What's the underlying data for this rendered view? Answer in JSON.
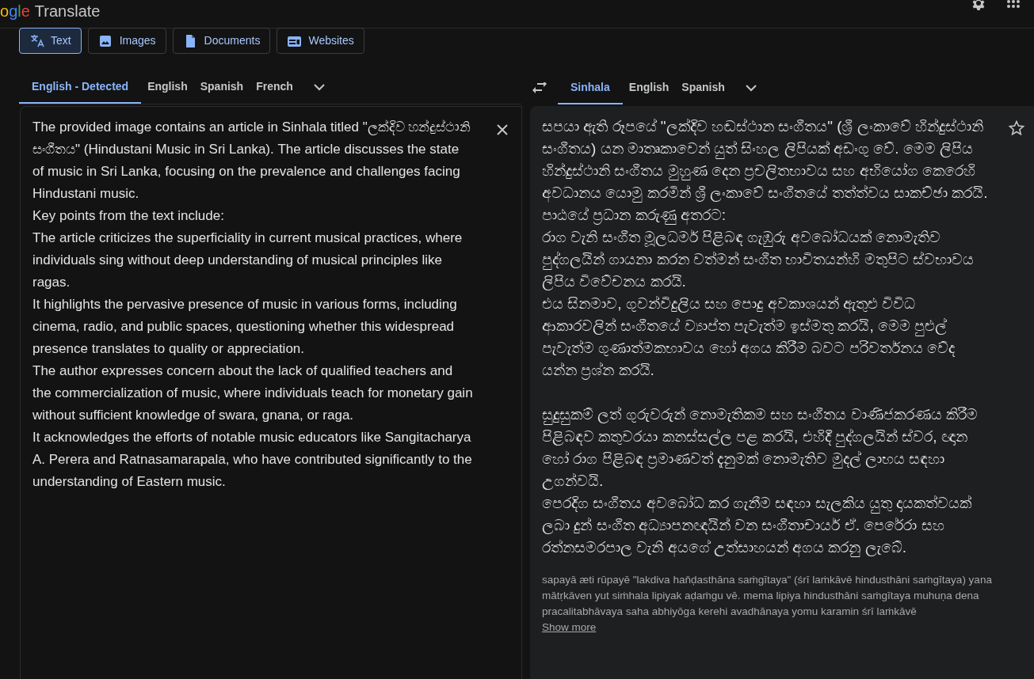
{
  "header": {
    "logo": "ogle",
    "title": "Translate"
  },
  "modes": [
    {
      "label": "Text",
      "kind": "text",
      "selected": true
    },
    {
      "label": "Images",
      "kind": "image",
      "selected": false
    },
    {
      "label": "Documents",
      "kind": "doc",
      "selected": false
    },
    {
      "label": "Websites",
      "kind": "web",
      "selected": false
    }
  ],
  "source_languages": [
    {
      "label": "English - Detected",
      "selected": true
    },
    {
      "label": "English",
      "selected": false
    },
    {
      "label": "Spanish",
      "selected": false
    },
    {
      "label": "French",
      "selected": false
    }
  ],
  "target_languages": [
    {
      "label": "Sinhala",
      "selected": true
    },
    {
      "label": "English",
      "selected": false
    },
    {
      "label": "Spanish",
      "selected": false
    }
  ],
  "source_text": [
    "The provided image contains an article in Sinhala titled \"ලක්දිව හන්දුස්ථානි සංගීතය\" (Hindustani Music in Sri Lanka). The article discusses the state of music in Sri Lanka, focusing on the prevalence and challenges facing Hindustani music.",
    "Key points from the text include:",
    "The article criticizes the superficiality in current musical practices, where individuals sing without deep understanding of musical principles like ragas.",
    "It highlights the pervasive presence of music in various forms, including cinema, radio, and public spaces, questioning whether this widespread presence translates to quality or appreciation.",
    "The author expresses concern about the lack of qualified teachers and the commercialization of music, where individuals teach for monetary gain without sufficient knowledge of swara, gnana, or raga.",
    "It acknowledges the efforts of notable music educators like Sangitacharya A. Perera and Ratnasamarapala, who have contributed significantly to the understanding of Eastern music."
  ],
  "translation": [
    [
      "සපයා ඇති රූපයේ \"ලක්දිව හඬස්ථාන සංගීතය\" (ශ්‍රී ලංකාවේ හින්දුස්ථානි සංගීතය) යන මාතෘකාවෙන් යුත් සිංහල ලිපියක් අඩංගු වේ. මෙම ලිපිය හින්දුස්ථානි සංගීතය මුහුණ දෙන ප්‍රචලිතභාවය සහ අභියෝග කෙරෙහි අවධානය යොමු කරමින් ශ්‍රී ලංකාවේ සංගීතයේ තත්ත්වය සාකච්ඡා කරයි.",
      "පාඨයේ ප්‍රධාන කරුණු අතරට:",
      "රාග වැනි සංගීත මූලධර්ම පිළිබඳ ගැඹුරු අවබෝධයක් නොමැතිව පුද්ගලයින් ගායනා කරන වත්මන් සංගීත භාවිතයන්හි මතුපිට ස්වභාවය ලිපිය විවේචනය කරයි.",
      "එය සිනමාව, ගුවන්විදුලිය සහ පොදු අවකාශයන් ඇතුළු විවිධ ආකාරවලින් සංගීතයේ ව්‍යාප්ත පැවැත්ම ඉස්මතු කරයි, මෙම පුළුල් පැවැත්ම ගුණාත්මකභාවය හෝ අගය කිරීම බවට පරිවර්තනය වේද යන්න ප්‍රශ්න කරයි."
    ],
    [
      "සුදුසුකම් ලත් ගුරුවරුන් නොමැතිකම සහ සංගීතය වාණිජකරණය කිරීම පිළිබඳව කතුවරයා කනස්සල්ල පළ කරයි, එහිදී පුද්ගලයින් ස්වර, ඥාන හෝ රාග පිළිබඳ ප්‍රමාණවත් දැනුමක් නොමැතිව මුදල් ලාභය සඳහා උගන්වයි.",
      "පෙරදිග සංගීතය අවබෝධ කර ගැනීම සඳහා සැලකිය යුතු දායකත්වයක් ලබා දුන් සංගීත අධ්‍යාපනඥයින් වන සංගීතාචාර්ය ඒ. පෙරේරා සහ රත්නසමරපාල වැනි අයගේ උත්සාහයන් අගය කරනු ලැබේ."
    ]
  ],
  "transliteration": "sapayā æti rūpayē \"lakdiva haňḍasthāna saṁgītaya\" (śrī laṁkāvē hindusthāni saṁgītaya) yana mātṛkāven yut siṁhala lipiyak aḍaṁgu vē. mema lipiya hindusthāni saṁgītaya muhuṇa dena pracalitabhāvaya saha abhiyōga kerehi avadhānaya yomu karamin śrī laṁkāvē",
  "show_more": "Show more"
}
